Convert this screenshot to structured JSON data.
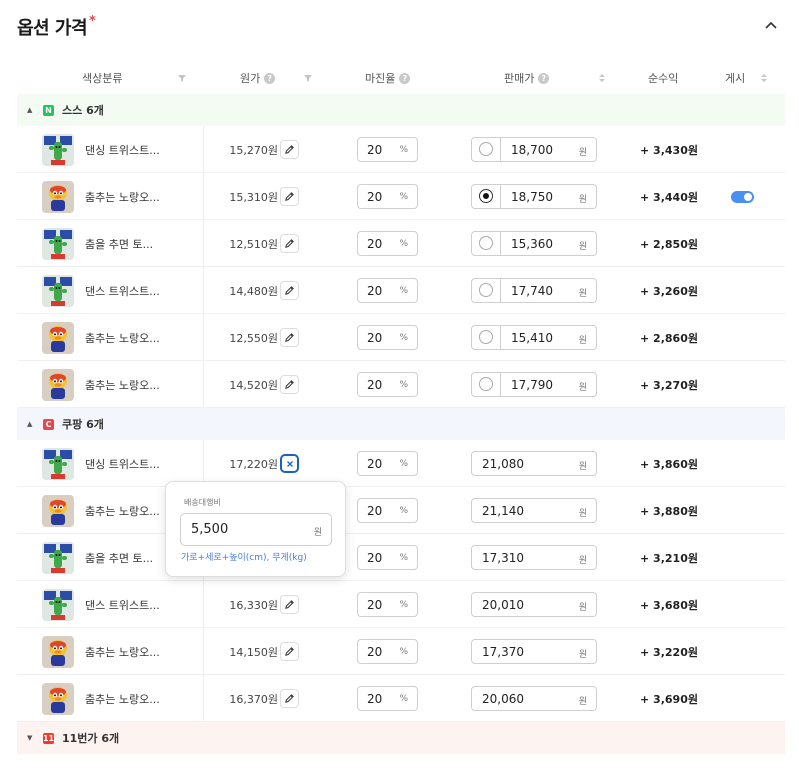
{
  "section": {
    "title": "옵션 가격",
    "required_mark": "*"
  },
  "columns": {
    "color": "색상분류",
    "cost": "원가",
    "margin": "마진율",
    "price": "판매가",
    "profit": "순수익",
    "post": "게시"
  },
  "help_glyph": "?",
  "groups": [
    {
      "label": "스스 6개",
      "badge": "N",
      "badge_color": "#21c45d",
      "bg": "#f3fbf3",
      "expanded": true,
      "rows": [
        {
          "name": "댄싱 트위스트...",
          "cost": "15,270원",
          "margin": "20",
          "price": "18,700",
          "profit": "+ 3,430원",
          "thumb": "cactus",
          "selected": false,
          "posted": false
        },
        {
          "name": "춤추는 노랑오...",
          "cost": "15,310원",
          "margin": "20",
          "price": "18,750",
          "profit": "+ 3,440원",
          "thumb": "duck",
          "selected": true,
          "posted": true
        },
        {
          "name": "춤을 추면 토...",
          "cost": "12,510원",
          "margin": "20",
          "price": "15,360",
          "profit": "+ 2,850원",
          "thumb": "cactus",
          "selected": false,
          "posted": false
        },
        {
          "name": "댄스 트위스트...",
          "cost": "14,480원",
          "margin": "20",
          "price": "17,740",
          "profit": "+ 3,260원",
          "thumb": "cactus",
          "selected": false,
          "posted": false
        },
        {
          "name": "춤추는 노랑오...",
          "cost": "12,550원",
          "margin": "20",
          "price": "15,410",
          "profit": "+ 2,860원",
          "thumb": "duck",
          "selected": false,
          "posted": false
        },
        {
          "name": "춤추는 노랑오...",
          "cost": "14,520원",
          "margin": "20",
          "price": "17,790",
          "profit": "+ 3,270원",
          "thumb": "duck",
          "selected": false,
          "posted": false
        }
      ]
    },
    {
      "label": "쿠팡 6개",
      "badge": "C",
      "badge_color": "#e8454d",
      "bg": "#f3f6fc",
      "expanded": true,
      "rows": [
        {
          "name": "댄싱 트위스트...",
          "cost": "17,220원",
          "margin": "20",
          "price": "21,080",
          "profit": "+ 3,860원",
          "thumb": "cactus",
          "editing": true
        },
        {
          "name": "춤추는 노랑오...",
          "cost": "",
          "margin": "20",
          "price": "21,140",
          "profit": "+ 3,880원",
          "thumb": "duck"
        },
        {
          "name": "춤을 추면 토...",
          "cost": "",
          "margin": "20",
          "price": "17,310",
          "profit": "+ 3,210원",
          "thumb": "cactus"
        },
        {
          "name": "댄스 트위스트...",
          "cost": "16,330원",
          "margin": "20",
          "price": "20,010",
          "profit": "+ 3,680원",
          "thumb": "cactus"
        },
        {
          "name": "춤추는 노랑오...",
          "cost": "14,150원",
          "margin": "20",
          "price": "17,370",
          "profit": "+ 3,220원",
          "thumb": "duck"
        },
        {
          "name": "춤추는 노랑오...",
          "cost": "16,370원",
          "margin": "20",
          "price": "20,060",
          "profit": "+ 3,690원",
          "thumb": "duck"
        }
      ]
    },
    {
      "label": "11번가 6개",
      "badge": "11",
      "badge_color": "#f23b2e",
      "bg": "#fdf3f1",
      "expanded": false,
      "rows": []
    }
  ],
  "units": {
    "percent": "%",
    "won": "원"
  },
  "popover": {
    "label": "배송대행비",
    "value": "5,500",
    "unit": "원",
    "hint": "가로+세로+높이(cm), 무게(kg)"
  }
}
